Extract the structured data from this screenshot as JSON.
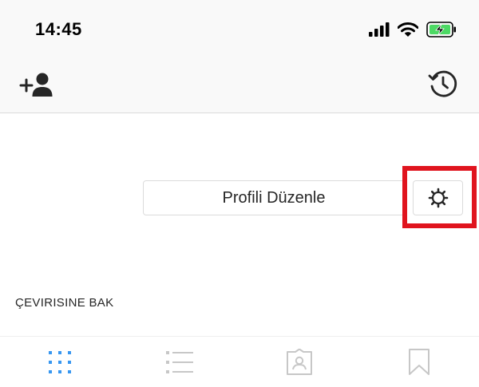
{
  "status_bar": {
    "time": "14:45",
    "icons": [
      "signal-icon",
      "wifi-icon",
      "battery-charging-icon"
    ]
  },
  "nav": {
    "left_icon": "add-user-icon",
    "right_icon": "history-icon"
  },
  "profile": {
    "edit_profile_label": "Profili Düzenle",
    "settings_icon": "gear-icon",
    "see_translation_label": "ÇEVIRISINE BAK"
  },
  "tabs": [
    {
      "name": "grid",
      "icon": "grid-icon",
      "active": true
    },
    {
      "name": "list",
      "icon": "list-icon",
      "active": false
    },
    {
      "name": "tagged",
      "icon": "tagged-icon",
      "active": false
    },
    {
      "name": "saved",
      "icon": "bookmark-icon",
      "active": false
    }
  ],
  "colors": {
    "active_tab": "#3897f0",
    "inactive_tab": "#c7c7c7",
    "highlight": "#e0141e",
    "battery": "#4cd964",
    "border": "#dbdbdb"
  }
}
